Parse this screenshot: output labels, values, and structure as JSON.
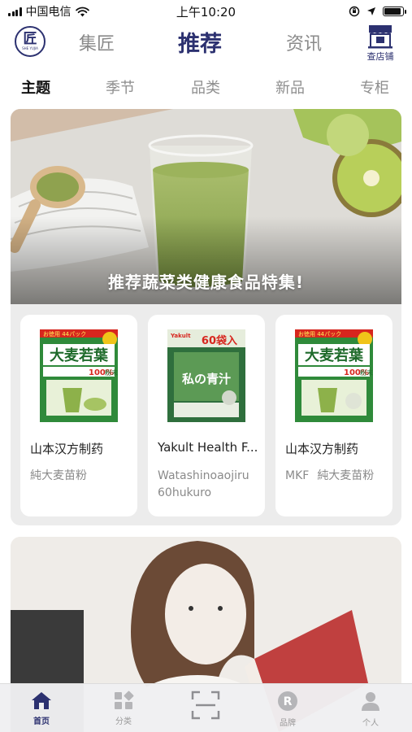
{
  "status_bar": {
    "carrier": "中国电信",
    "time": "上午10:20",
    "battery_level": 0.9
  },
  "header": {
    "logo": {
      "glyph": "匠",
      "subtext": "SHE YUJIA"
    },
    "tabs": [
      {
        "label": "集匠",
        "active": false
      },
      {
        "label": "推荐",
        "active": true
      },
      {
        "label": "资讯",
        "active": false
      }
    ],
    "store_button": {
      "icon": "store-icon",
      "label": "查店铺"
    }
  },
  "subtabs": [
    {
      "label": "主题",
      "active": true
    },
    {
      "label": "季节",
      "active": false
    },
    {
      "label": "品类",
      "active": false
    },
    {
      "label": "新品",
      "active": false
    },
    {
      "label": "专柜",
      "active": false
    }
  ],
  "feature": {
    "caption": "推荐蔬菜类健康食品特集!",
    "products": [
      {
        "name": "山本汉方制药",
        "subtitle_lines": [
          "純大麦苗粉"
        ],
        "package": {
          "badge": "お徳用 44パック",
          "title": "大麦若葉",
          "percent": "100%",
          "word": "粉末",
          "color": "#2f8a3a"
        }
      },
      {
        "name": "Yakult Health F...",
        "subtitle_lines": [
          "Watashinoaojiru",
          "60hukuro"
        ],
        "package": {
          "brand": "Yakult",
          "count": "60袋入",
          "title": "私の青汁",
          "color": "#2f6f3d"
        }
      },
      {
        "name": "山本汉方制药",
        "subtitle_lines": [
          "MKF",
          "純大麦苗粉"
        ],
        "package": {
          "badge": "お徳用 44パック",
          "title": "大麦若葉",
          "percent": "100%",
          "word": "粉末",
          "color": "#2f8a3a"
        }
      }
    ]
  },
  "tab_bar": {
    "items": [
      {
        "label": "首页",
        "icon": "home-icon",
        "active": true
      },
      {
        "label": "分类",
        "icon": "category-icon",
        "active": false
      },
      {
        "label": "",
        "icon": "scan-icon",
        "active": false
      },
      {
        "label": "品牌",
        "icon": "brand-icon",
        "active": false
      },
      {
        "label": "个人",
        "icon": "user-icon",
        "active": false
      }
    ]
  },
  "colors": {
    "brand": "#2c3170",
    "inactive_text": "#8a8a8a",
    "card_bg": "#ececec"
  }
}
